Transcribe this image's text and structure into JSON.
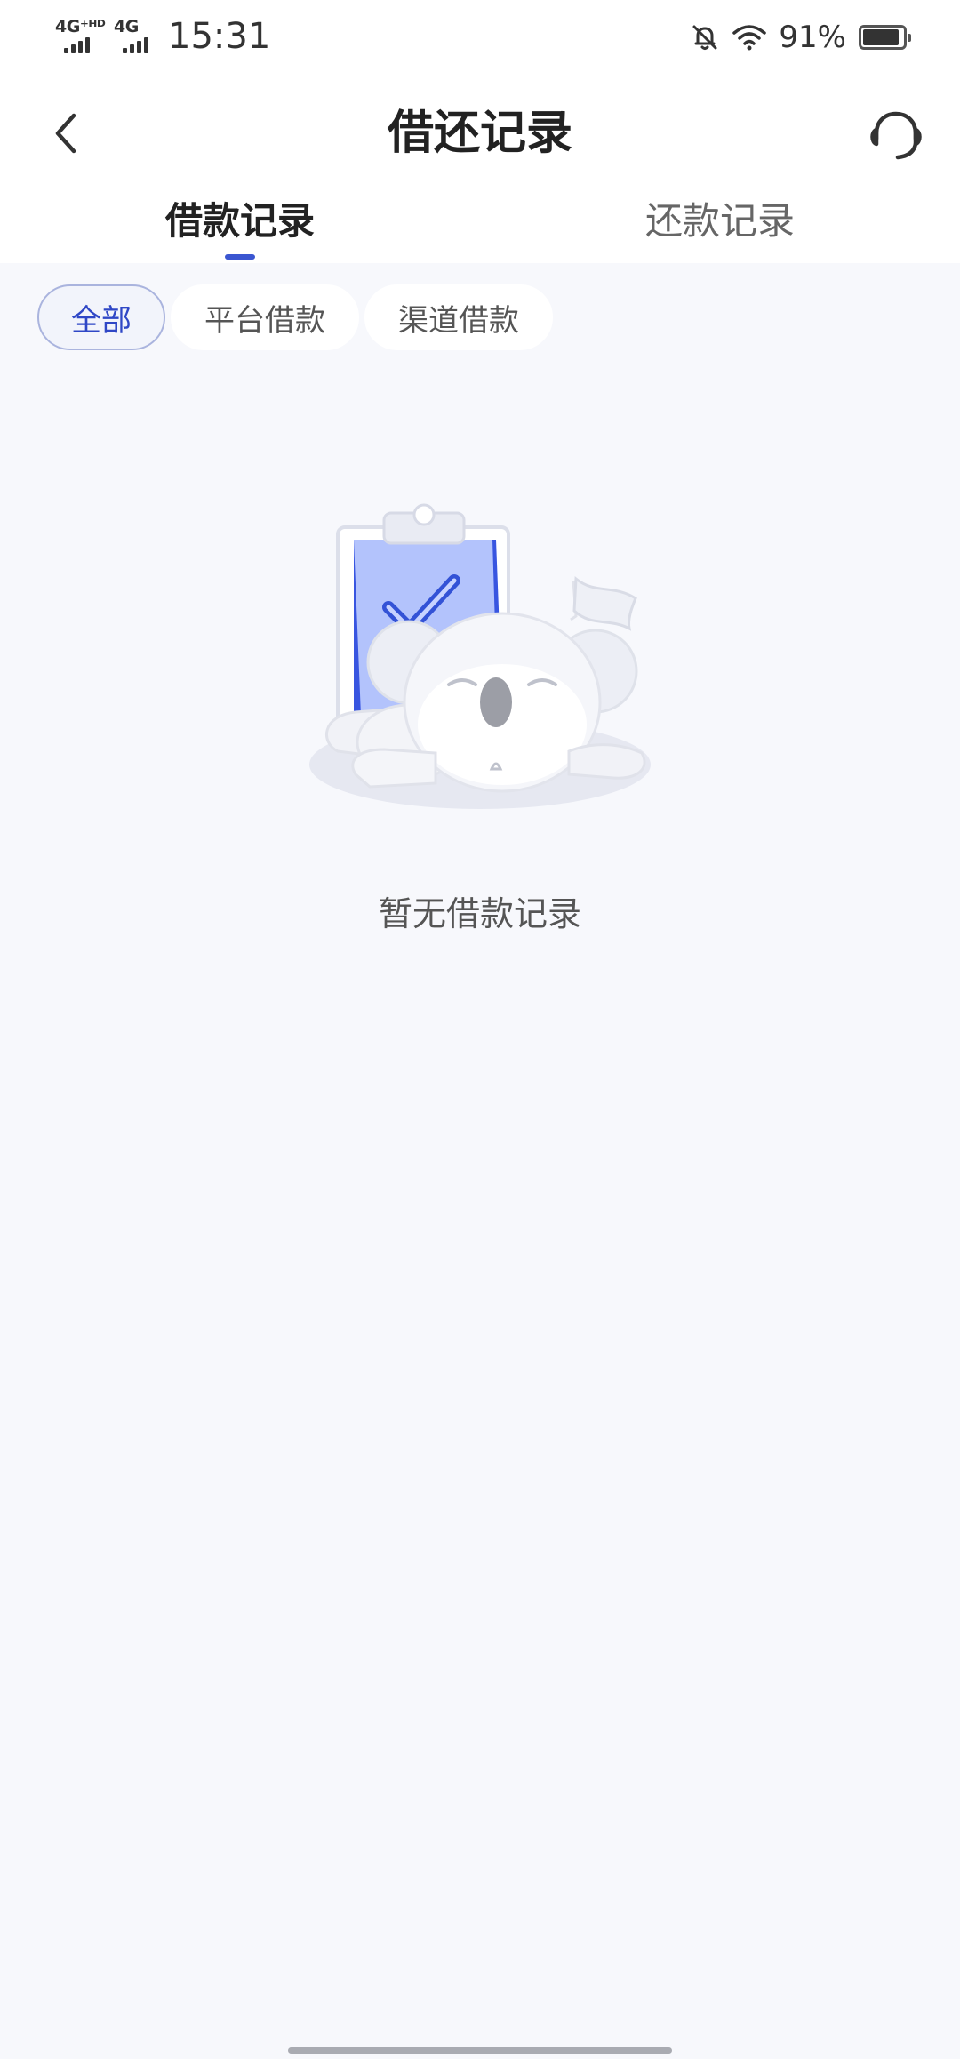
{
  "status_bar": {
    "network_1": "4G⁺ᴴᴰ",
    "network_2": "4G",
    "time": "15:31",
    "battery_percent": "91%",
    "battery_level": 0.91
  },
  "header": {
    "title": "借还记录",
    "back_icon": "chevron-left-icon",
    "service_icon": "headset-icon"
  },
  "tabs": [
    {
      "label": "借款记录",
      "active": true
    },
    {
      "label": "还款记录",
      "active": false
    }
  ],
  "filters": [
    {
      "label": "全部",
      "selected": true
    },
    {
      "label": "平台借款",
      "selected": false
    },
    {
      "label": "渠道借款",
      "selected": false
    }
  ],
  "empty_state": {
    "illustration": "sleeping-koala-clipboard-illustration",
    "message": "暂无借款记录"
  },
  "colors": {
    "accent": "#3b56d1",
    "chip_selected_text": "#2f47c6",
    "page_background": "#f7f8fc"
  }
}
